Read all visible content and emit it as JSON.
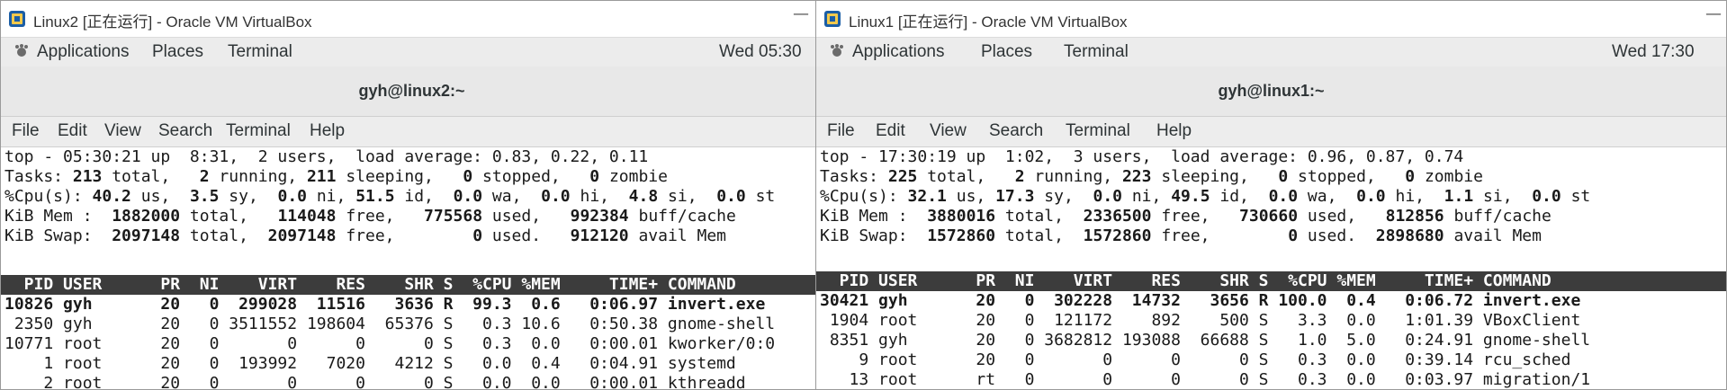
{
  "windows": {
    "linux2": {
      "title": "Linux2 [正在运行] - Oracle VM VirtualBox",
      "minimize_glyph": "—",
      "gnome": {
        "applications": "Applications",
        "places": "Places",
        "terminal": "Terminal",
        "clock": "Wed 05:30"
      },
      "terminal_title": "gyh@linux2:~",
      "menu": {
        "file": "File",
        "edit": "Edit",
        "view": "View",
        "search": "Search",
        "terminal": "Terminal",
        "help": "Help"
      },
      "top": {
        "summary": [
          {
            "p": [
              "top - 05:30:21 up  8:31,  2 users,  load average: 0.83, 0.22, 0.11"
            ],
            "b": []
          },
          {
            "p": [
              "Tasks: ",
              " total,   ",
              " running, ",
              " sleeping,   ",
              " stopped,   ",
              " zombie"
            ],
            "b": [
              "213",
              "2",
              "211",
              "0",
              "0"
            ]
          },
          {
            "p": [
              "%Cpu(s): ",
              " us,  ",
              " sy,  ",
              " ni, ",
              " id,  ",
              " wa,  ",
              " hi,  ",
              " si,  ",
              " st"
            ],
            "b": [
              "40.2",
              "3.5",
              "0.0",
              "51.5",
              "0.0",
              "0.0",
              "4.8",
              "0.0"
            ]
          },
          {
            "p": [
              "KiB Mem :  ",
              " total,   ",
              " free,   ",
              " used,   ",
              " buff/cache"
            ],
            "b": [
              "1882000",
              "114048",
              "775568",
              "992384"
            ]
          },
          {
            "p": [
              "KiB Swap:  ",
              " total,  ",
              " free,        ",
              " used.   ",
              " avail Mem"
            ],
            "b": [
              "2097148",
              "2097148",
              "0",
              "912120"
            ]
          }
        ],
        "header": "  PID USER      PR  NI    VIRT    RES    SHR S  %CPU %MEM     TIME+ COMMAND",
        "rows": [
          {
            "text": "10826 gyh       20   0  299028  11516   3636 R  99.3  0.6   0:06.97 invert.exe",
            "bold": true
          },
          {
            "text": " 2350 gyh       20   0 3511552 198604  65376 S   0.3 10.6   0:50.38 gnome-shell",
            "bold": false
          },
          {
            "text": "10771 root      20   0       0      0      0 S   0.3  0.0   0:00.01 kworker/0:0",
            "bold": false
          },
          {
            "text": "    1 root      20   0  193992   7020   4212 S   0.0  0.4   0:04.91 systemd",
            "bold": false
          },
          {
            "text": "    2 root      20   0       0      0      0 S   0.0  0.0   0:00.01 kthreadd",
            "bold": false
          }
        ]
      }
    },
    "linux1": {
      "title": "Linux1 [正在运行] - Oracle VM VirtualBox",
      "minimize_glyph": "—",
      "gnome": {
        "applications": "Applications",
        "places": "Places",
        "terminal": "Terminal",
        "clock": "Wed 17:30"
      },
      "terminal_title": "gyh@linux1:~",
      "menu": {
        "file": "File",
        "edit": "Edit",
        "view": "View",
        "search": "Search",
        "terminal": "Terminal",
        "help": "Help"
      },
      "top": {
        "summary": [
          {
            "p": [
              "top - 17:30:19 up  1:02,  3 users,  load average: 0.96, 0.87, 0.74"
            ],
            "b": []
          },
          {
            "p": [
              "Tasks: ",
              " total,   ",
              " running, ",
              " sleeping,   ",
              " stopped,   ",
              " zombie"
            ],
            "b": [
              "225",
              "2",
              "223",
              "0",
              "0"
            ]
          },
          {
            "p": [
              "%Cpu(s): ",
              " us, ",
              " sy,  ",
              " ni, ",
              " id,  ",
              " wa,  ",
              " hi,  ",
              " si,  ",
              " st"
            ],
            "b": [
              "32.1",
              "17.3",
              "0.0",
              "49.5",
              "0.0",
              "0.0",
              "1.1",
              "0.0"
            ]
          },
          {
            "p": [
              "KiB Mem :  ",
              " total,  ",
              " free,   ",
              " used,   ",
              " buff/cache"
            ],
            "b": [
              "3880016",
              "2336500",
              "730660",
              "812856"
            ]
          },
          {
            "p": [
              "KiB Swap:  ",
              " total,  ",
              " free,        ",
              " used.  ",
              " avail Mem"
            ],
            "b": [
              "1572860",
              "1572860",
              "0",
              "2898680"
            ]
          }
        ],
        "header": "  PID USER      PR  NI    VIRT    RES    SHR S  %CPU %MEM     TIME+ COMMAND",
        "rows": [
          {
            "text": "30421 gyh       20   0  302228  14732   3656 R 100.0  0.4   0:06.72 invert.exe",
            "bold": true
          },
          {
            "text": " 1904 root      20   0  121172    892    500 S   3.3  0.0   1:01.39 VBoxClient",
            "bold": false
          },
          {
            "text": " 8351 gyh       20   0 3682812 193088  66688 S   1.0  5.0   0:24.91 gnome-shell",
            "bold": false
          },
          {
            "text": "    9 root      20   0       0      0      0 S   0.3  0.0   0:39.14 rcu_sched",
            "bold": false
          },
          {
            "text": "   13 root      rt   0       0      0      0 S   0.3  0.0   0:03.97 migration/1",
            "bold": false
          }
        ]
      }
    }
  }
}
